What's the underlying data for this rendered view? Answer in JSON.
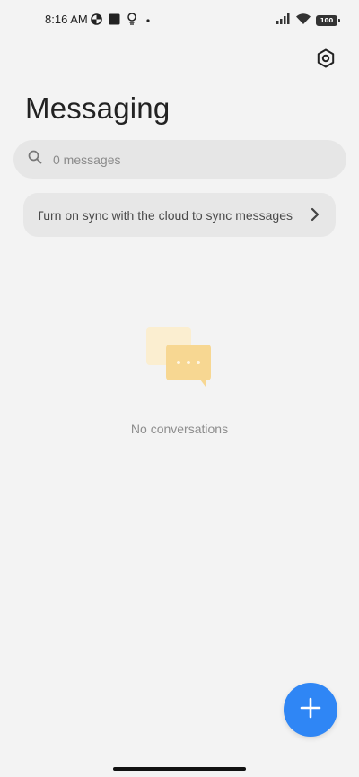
{
  "status_bar": {
    "time": "8:16 AM",
    "battery_level": "100",
    "icons": [
      "data-saver-icon",
      "square-notification-icon",
      "lightbulb-icon",
      "dot-icon",
      "signal-icon",
      "wifi-icon",
      "battery-icon"
    ]
  },
  "header": {
    "title": "Messaging",
    "settings_icon": "settings-hexagon-icon"
  },
  "search": {
    "placeholder": "0 messages",
    "value": ""
  },
  "sync_banner": {
    "text": "Turn on sync with the cloud to sync messages"
  },
  "empty_state": {
    "text": "No conversations",
    "icon": "chat-bubbles-icon"
  },
  "fab": {
    "icon": "plus-icon"
  },
  "colors": {
    "background": "#f3f3f3",
    "accent": "#2f86f5",
    "illustration": "#f7d792"
  }
}
